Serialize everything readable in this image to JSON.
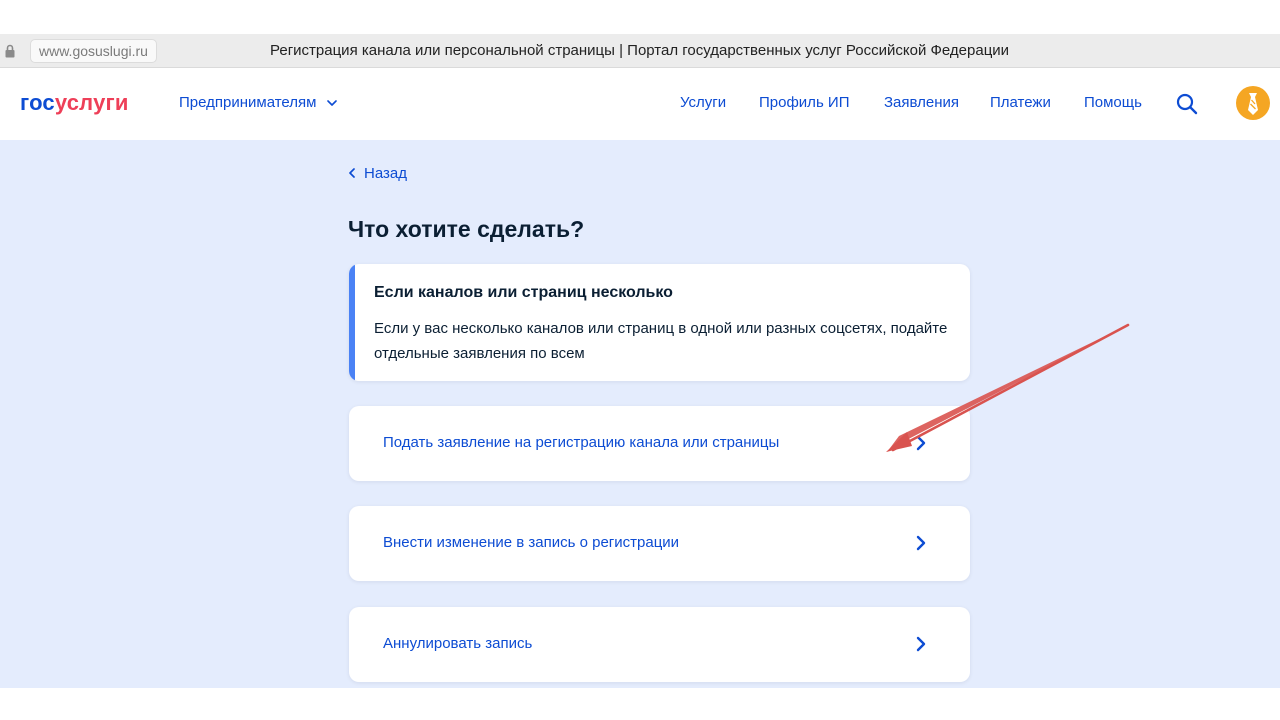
{
  "browser": {
    "url": "www.gosuslugi.ru",
    "page_title": "Регистрация канала или персональной страницы | Портал государственных услуг Российской Федерации"
  },
  "header": {
    "logo_part1": "гос",
    "logo_part2": "услуги",
    "segment": "Предпринимателям",
    "nav": [
      "Услуги",
      "Профиль ИП",
      "Заявления",
      "Платежи",
      "Помощь"
    ]
  },
  "main": {
    "back": "Назад",
    "heading": "Что хотите сделать?",
    "info": {
      "title": "Если каналов или страниц несколько",
      "text": "Если у вас несколько каналов или страниц в одной или разных соцсетях, подайте отдельные заявления по всем"
    },
    "options": [
      "Подать заявление на регистрацию канала или страницы",
      "Внести изменение в запись о регистрации",
      "Аннулировать запись"
    ]
  },
  "colors": {
    "brand_blue": "#0d4cd3",
    "brand_red": "#ee3f58",
    "page_bg": "#e4ecfd",
    "info_accent": "#4a82f5",
    "annotation_arrow": "#d9534f",
    "avatar": "#f5a623"
  }
}
